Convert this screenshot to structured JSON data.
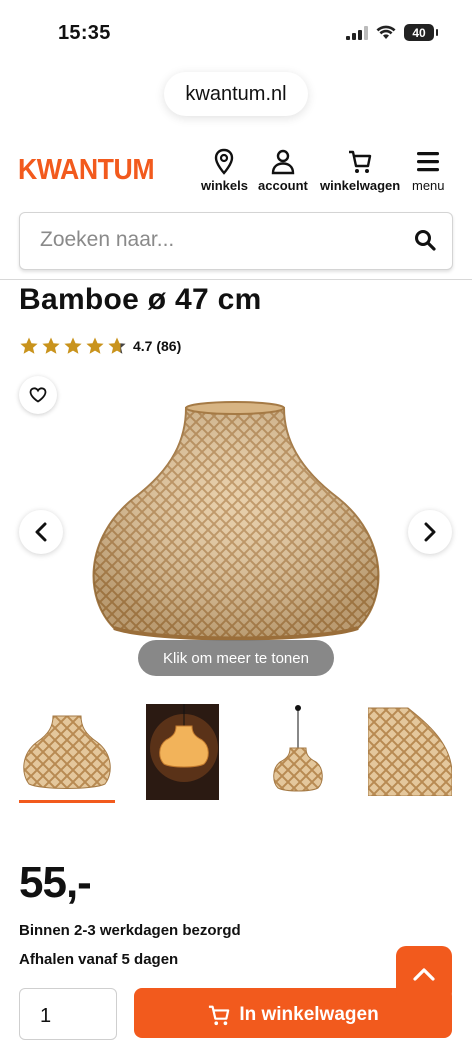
{
  "status": {
    "time": "15:35",
    "battery": "40"
  },
  "browser": {
    "url": "kwantum.nl"
  },
  "header": {
    "logo": "KWANTUM",
    "nav": {
      "stores": "winkels",
      "account": "account",
      "cart": "winkelwagen",
      "menu": "menu"
    }
  },
  "search": {
    "placeholder": "Zoeken naar..."
  },
  "product": {
    "title": "Bamboe ø 47 cm",
    "rating": {
      "score": "4.7",
      "count": "(86)",
      "display": "4.7 (86)",
      "stars": 4.7
    },
    "image_hint": "Klik om meer te tonen",
    "price": "55,-",
    "delivery": [
      "Binnen 2-3 werkdagen bezorgd",
      "Afhalen vanaf 5 dagen"
    ],
    "quantity": "1",
    "add_to_cart": "In winkelwagen"
  },
  "colors": {
    "brand": "#f25a1d"
  }
}
